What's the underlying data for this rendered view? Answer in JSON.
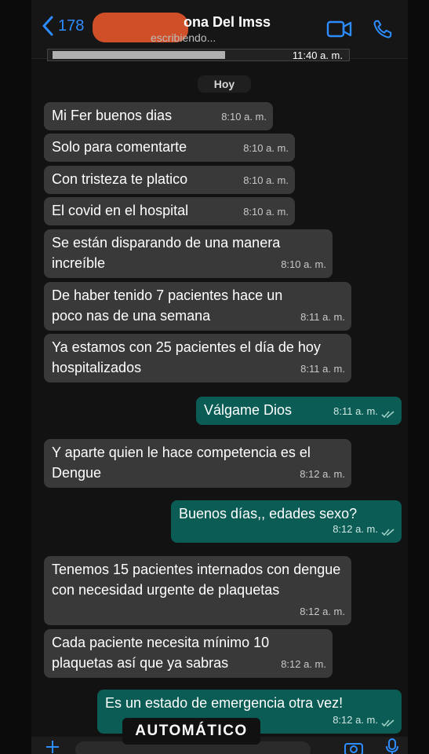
{
  "header": {
    "back_count": "178",
    "contact_name": "ona Del Imss",
    "status": "escribiendo...",
    "icons": [
      "video-call-icon",
      "phone-call-icon"
    ]
  },
  "preview": {
    "time": "11:40 a. m."
  },
  "day_label": "Hoy",
  "messages": [
    {
      "text": "Mi Fer buenos dias",
      "time": "8:10 a. m."
    },
    {
      "text": "Solo para comentarte",
      "time": "8:10 a. m."
    },
    {
      "text": "Con tristeza te platico",
      "time": "8:10 a. m."
    },
    {
      "text": "El covid en el hospital",
      "time": "8:10 a. m."
    },
    {
      "text": "Se están disparando de una manera increíble",
      "time": "8:10 a. m."
    },
    {
      "text": "De haber tenido 7 pacientes hace un poco nas de una semana",
      "time": "8:11 a. m."
    },
    {
      "text": "Ya estamos con 25 pacientes el día de hoy hospitalizados",
      "time": "8:11 a. m."
    },
    {
      "text": "Válgame Dios",
      "time": "8:11 a. m."
    },
    {
      "text": "Y aparte quien le hace competencia es el Dengue",
      "time": "8:12 a. m."
    },
    {
      "text": "Buenos días,, edades sexo?",
      "time": "8:12 a. m."
    },
    {
      "text": "Tenemos 15 pacientes internados con dengue con necesidad urgente de plaquetas",
      "time": "8:12 a. m."
    },
    {
      "text": "Cada paciente necesita mínimo 10 plaquetas así que ya sabras",
      "time": "8:12 a. m."
    },
    {
      "text": "Es un estado de emergencia otra vez!",
      "time": "8:12 a. m."
    }
  ],
  "toast": "AUTOMÁTICO",
  "colors": {
    "incoming": "#393939",
    "outgoing": "#0a5c55",
    "accent": "#2d8cff"
  }
}
